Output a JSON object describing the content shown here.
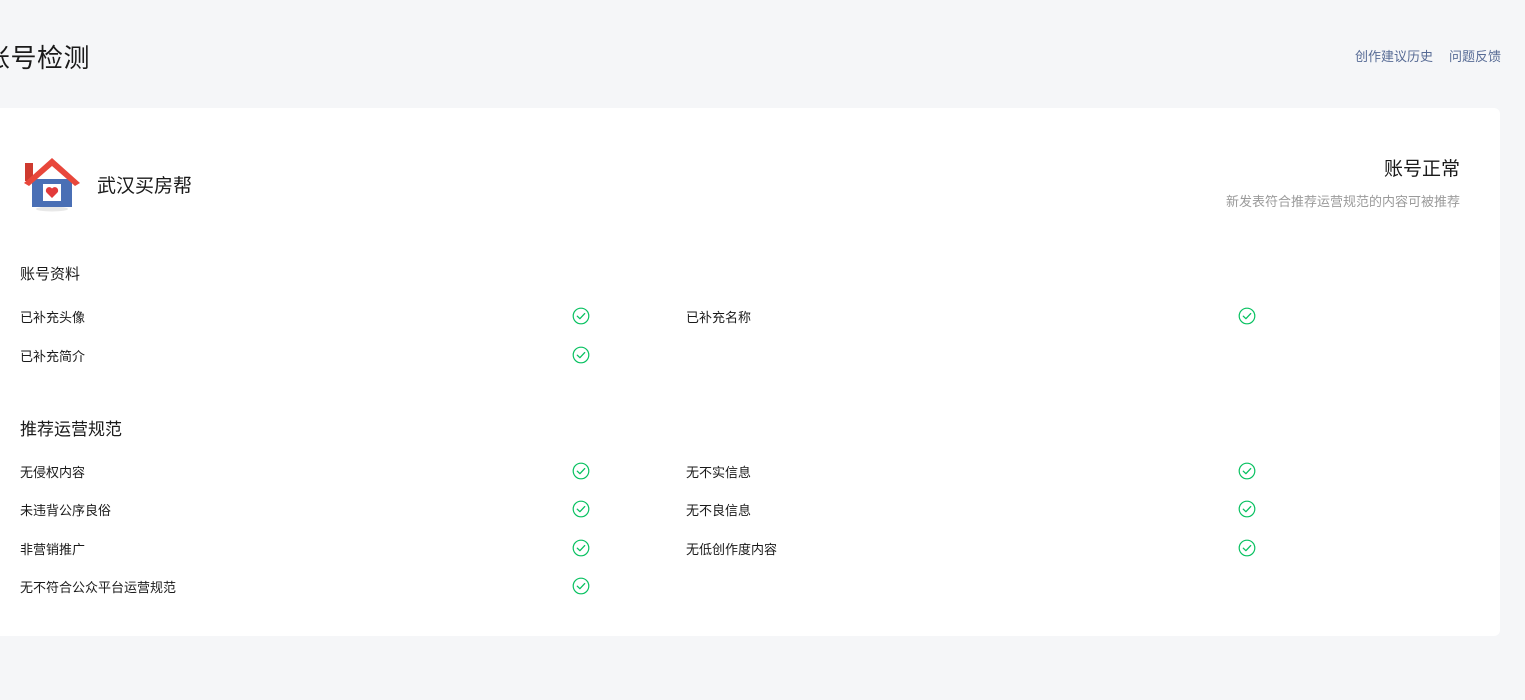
{
  "header": {
    "title": "账号检测",
    "links": [
      "创作建议历史",
      "问题反馈"
    ]
  },
  "account": {
    "name": "武汉买房帮",
    "avatar_icon": "house-heart-icon",
    "status_title": "账号正常",
    "status_desc": "新发表符合推荐运营规范的内容可被推荐"
  },
  "sections": {
    "profile": {
      "title": "账号资料",
      "items": [
        "已补充头像",
        "已补充名称",
        "已补充简介"
      ]
    },
    "rules": {
      "title": "推荐运营规范",
      "items": [
        "无侵权内容",
        "无不实信息",
        "未违背公序良俗",
        "无不良信息",
        "非营销推广",
        "无低创作度内容",
        "无不符合公众平台运营规范"
      ]
    }
  },
  "colors": {
    "check_green": "#07c160",
    "link_blue": "#576b95",
    "page_bg": "#f5f6f8"
  },
  "icons": {
    "check": "check-circle-icon"
  }
}
